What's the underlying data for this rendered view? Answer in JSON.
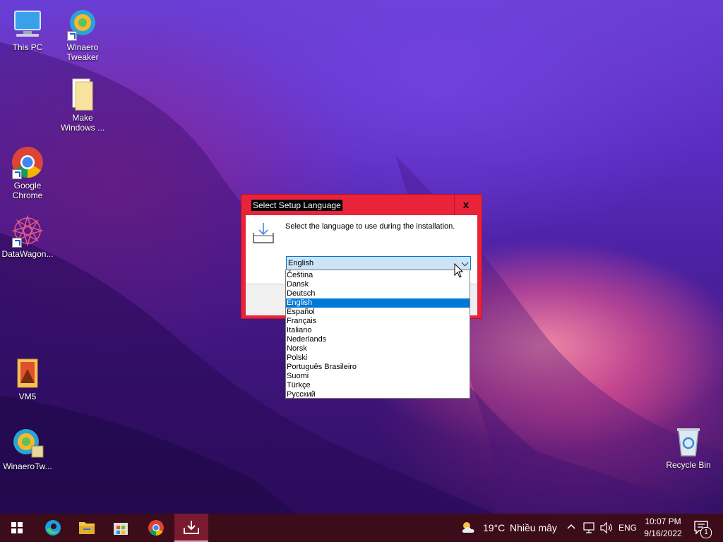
{
  "desktop": {
    "icons": [
      {
        "label": "This PC"
      },
      {
        "label": "Winaero\nTweaker"
      },
      {
        "label": "Make\nWindows ..."
      },
      {
        "label": "Google\nChrome"
      },
      {
        "label": "DataWagon..."
      },
      {
        "label": "VM5"
      },
      {
        "label": "WinaeroTw..."
      },
      {
        "label": "Recycle Bin"
      }
    ]
  },
  "dialog": {
    "title": "Select Setup Language",
    "close_label": "x",
    "prompt": "Select the language to use during the installation.",
    "selected_language": "English",
    "languages": [
      "Čeština",
      "Dansk",
      "Deutsch",
      "English",
      "Español",
      "Français",
      "Italiano",
      "Nederlands",
      "Norsk",
      "Polski",
      "Português Brasileiro",
      "Suomi",
      "Türkçe",
      "Русский"
    ]
  },
  "taskbar": {
    "weather_temp": "19°C",
    "weather_text": "Nhiều mây",
    "language": "ENG",
    "time": "10:07 PM",
    "date": "9/16/2022",
    "notification_count": "1"
  },
  "colors": {
    "dialog_frame": "#e8233a",
    "selection": "#0078d7",
    "taskbar": "#3c0c1a"
  }
}
